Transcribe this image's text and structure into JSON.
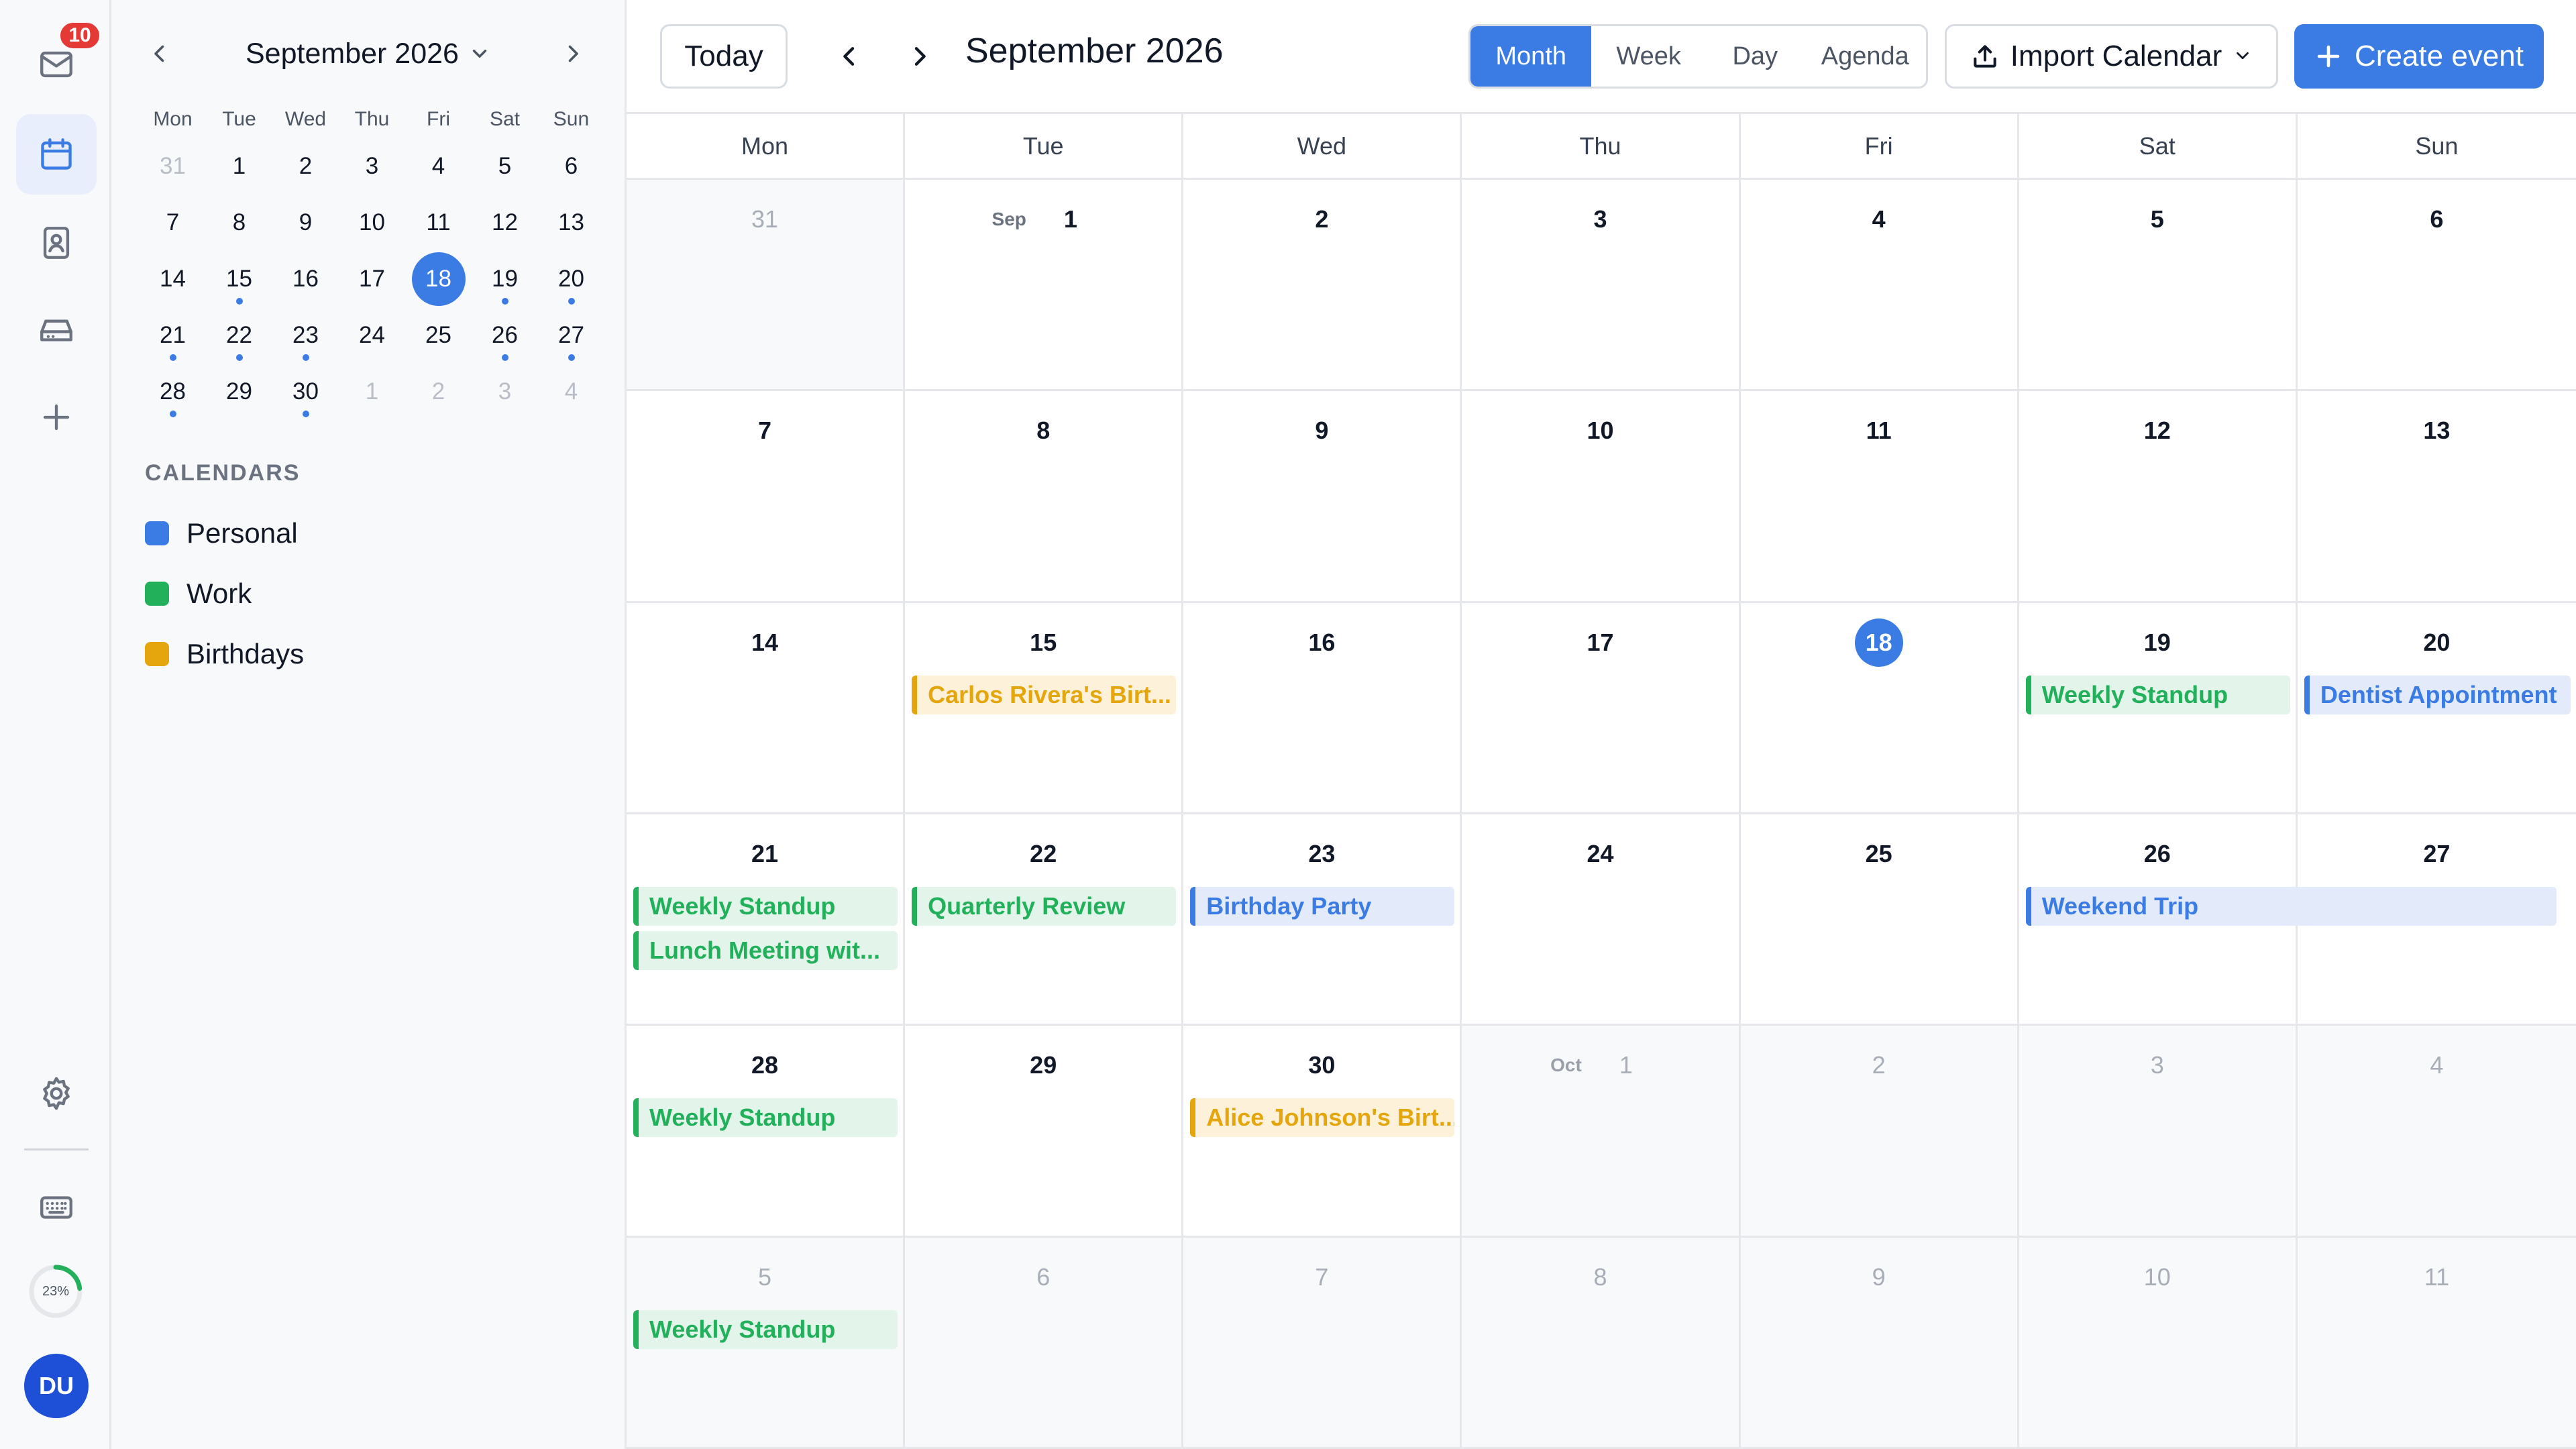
{
  "rail": {
    "mail_badge": "10",
    "progress_label": "23%",
    "progress_value": 0.23,
    "avatar_initials": "DU",
    "icons": [
      "mail-icon",
      "calendar-icon",
      "contacts-icon",
      "drive-icon",
      "plus-icon",
      "gear-icon",
      "keyboard-icon"
    ]
  },
  "mini_calendar": {
    "title": "September 2026",
    "weekdays": [
      "Mon",
      "Tue",
      "Wed",
      "Thu",
      "Fri",
      "Sat",
      "Sun"
    ],
    "weeks": [
      [
        {
          "d": "31",
          "m": true
        },
        {
          "d": "1"
        },
        {
          "d": "2"
        },
        {
          "d": "3"
        },
        {
          "d": "4"
        },
        {
          "d": "5"
        },
        {
          "d": "6"
        }
      ],
      [
        {
          "d": "7"
        },
        {
          "d": "8"
        },
        {
          "d": "9"
        },
        {
          "d": "10"
        },
        {
          "d": "11"
        },
        {
          "d": "12"
        },
        {
          "d": "13"
        }
      ],
      [
        {
          "d": "14"
        },
        {
          "d": "15",
          "dot": true
        },
        {
          "d": "16"
        },
        {
          "d": "17"
        },
        {
          "d": "18",
          "today": true
        },
        {
          "d": "19",
          "dot": true
        },
        {
          "d": "20",
          "dot": true
        }
      ],
      [
        {
          "d": "21",
          "dot": true
        },
        {
          "d": "22",
          "dot": true
        },
        {
          "d": "23",
          "dot": true
        },
        {
          "d": "24"
        },
        {
          "d": "25"
        },
        {
          "d": "26",
          "dot": true
        },
        {
          "d": "27",
          "dot": true
        }
      ],
      [
        {
          "d": "28",
          "dot": true
        },
        {
          "d": "29"
        },
        {
          "d": "30",
          "dot": true
        },
        {
          "d": "1",
          "m": true
        },
        {
          "d": "2",
          "m": true
        },
        {
          "d": "3",
          "m": true
        },
        {
          "d": "4",
          "m": true
        }
      ]
    ]
  },
  "calendars": {
    "section_title": "CALENDARS",
    "items": [
      {
        "name": "Personal",
        "color": "#3b7be4"
      },
      {
        "name": "Work",
        "color": "#22b05a"
      },
      {
        "name": "Birthdays",
        "color": "#e5a50d"
      }
    ]
  },
  "toolbar": {
    "today_label": "Today",
    "title": "September 2026",
    "views": [
      {
        "label": "Month",
        "active": true
      },
      {
        "label": "Week"
      },
      {
        "label": "Day"
      },
      {
        "label": "Agenda"
      }
    ],
    "import_label": "Import Calendar",
    "create_label": "Create event"
  },
  "month_view": {
    "weekdays": [
      "Mon",
      "Tue",
      "Wed",
      "Thu",
      "Fri",
      "Sat",
      "Sun"
    ],
    "days": [
      {
        "d": "31",
        "other": true
      },
      {
        "d": "1",
        "month": "Sep"
      },
      {
        "d": "2"
      },
      {
        "d": "3"
      },
      {
        "d": "4"
      },
      {
        "d": "5"
      },
      {
        "d": "6"
      },
      {
        "d": "7"
      },
      {
        "d": "8"
      },
      {
        "d": "9"
      },
      {
        "d": "10"
      },
      {
        "d": "11"
      },
      {
        "d": "12"
      },
      {
        "d": "13"
      },
      {
        "d": "14"
      },
      {
        "d": "15",
        "events": [
          {
            "title": "Carlos Rivera's Birt...",
            "cal": "birthday"
          }
        ]
      },
      {
        "d": "16"
      },
      {
        "d": "17"
      },
      {
        "d": "18",
        "today": true
      },
      {
        "d": "19",
        "events": [
          {
            "title": "Weekly Standup",
            "cal": "work"
          }
        ]
      },
      {
        "d": "20",
        "events": [
          {
            "title": "Dentist Appointment",
            "cal": "personal"
          }
        ]
      },
      {
        "d": "21",
        "events": [
          {
            "title": "Weekly Standup",
            "cal": "work"
          },
          {
            "title": "Lunch Meeting wit...",
            "cal": "work"
          }
        ]
      },
      {
        "d": "22",
        "events": [
          {
            "title": "Quarterly Review",
            "cal": "work"
          }
        ]
      },
      {
        "d": "23",
        "events": [
          {
            "title": "Birthday Party",
            "cal": "personal"
          }
        ]
      },
      {
        "d": "24"
      },
      {
        "d": "25"
      },
      {
        "d": "26",
        "events": [
          {
            "title": "Weekend Trip",
            "cal": "personal",
            "span": 2
          }
        ]
      },
      {
        "d": "27"
      },
      {
        "d": "28",
        "events": [
          {
            "title": "Weekly Standup",
            "cal": "work"
          }
        ]
      },
      {
        "d": "29"
      },
      {
        "d": "30",
        "events": [
          {
            "title": "Alice Johnson's Birt...",
            "cal": "birthday"
          }
        ]
      },
      {
        "d": "1",
        "month": "Oct",
        "other": true
      },
      {
        "d": "2",
        "other": true
      },
      {
        "d": "3",
        "other": true
      },
      {
        "d": "4",
        "other": true
      },
      {
        "d": "5",
        "other": true,
        "events": [
          {
            "title": "Weekly Standup",
            "cal": "work"
          }
        ]
      },
      {
        "d": "6",
        "other": true
      },
      {
        "d": "7",
        "other": true
      },
      {
        "d": "8",
        "other": true
      },
      {
        "d": "9",
        "other": true
      },
      {
        "d": "10",
        "other": true
      },
      {
        "d": "11",
        "other": true
      }
    ]
  }
}
